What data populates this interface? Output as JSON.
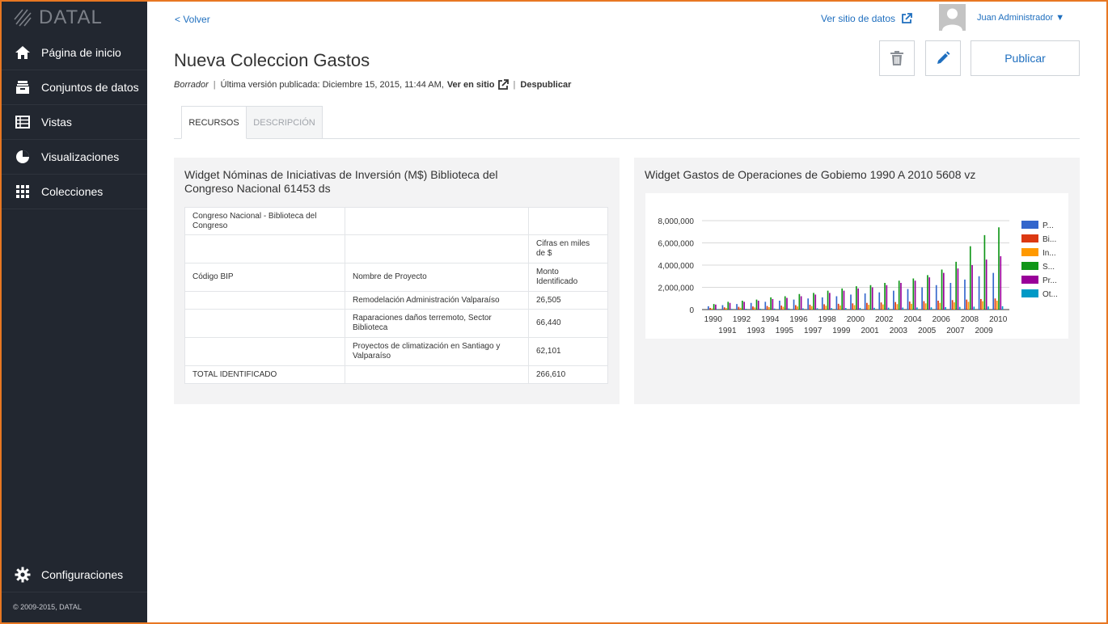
{
  "sidebar": {
    "brand": "DATAL",
    "items": [
      {
        "label": "Página de inicio"
      },
      {
        "label": "Conjuntos de datos"
      },
      {
        "label": "Vistas"
      },
      {
        "label": "Visualizaciones"
      },
      {
        "label": "Colecciones"
      }
    ],
    "settings_label": "Configuraciones",
    "copyright": "© 2009-2015, DATAL"
  },
  "header": {
    "back_label": "< Volver",
    "site_link_label": "Ver sitio de datos",
    "user_name": "Juan Administrador ▼",
    "title": "Nueva Coleccion Gastos",
    "status": "Borrador",
    "published_text": "Última versión publicada: Diciembre 15, 2015, 11:44 AM,",
    "view_on_site": "Ver en sitio",
    "unpublish": "Despublicar",
    "publish_button": "Publicar"
  },
  "tabs": [
    {
      "label": "RECURSOS"
    },
    {
      "label": "DESCRIPCIÓN"
    }
  ],
  "widget1": {
    "title": "Widget Nóminas de Iniciativas de Inversión (M$) Biblioteca del Congreso Nacional 61453 ds",
    "rows": [
      [
        "Congreso Nacional - Biblioteca del Congreso",
        "",
        ""
      ],
      [
        "",
        "",
        "Cifras en miles de $"
      ],
      [
        "Código BIP",
        "Nombre de Proyecto",
        "Monto Identificado"
      ],
      [
        "",
        "Remodelación Administración Valparaíso",
        "26,505"
      ],
      [
        "",
        "Raparaciones daños terremoto, Sector Biblioteca",
        "66,440"
      ],
      [
        "",
        "Proyectos de climatización en Santiago y Valparaíso",
        "62,101"
      ],
      [
        "TOTAL IDENTIFICADO",
        "",
        "266,610"
      ]
    ]
  },
  "widget2": {
    "title": "Widget Gastos de Operaciones de Gobiemo 1990 A 2010 5608 vz"
  },
  "chart_data": {
    "type": "bar",
    "title": "",
    "xlabel": "",
    "ylabel": "",
    "ylim": [
      0,
      8000000
    ],
    "y_ticks": [
      "0",
      "2,000,000",
      "4,000,000",
      "6,000,000",
      "8,000,000"
    ],
    "categories": [
      "1990",
      "1991",
      "1992",
      "1993",
      "1994",
      "1995",
      "1996",
      "1997",
      "1998",
      "1999",
      "2000",
      "2001",
      "2002",
      "2003",
      "2004",
      "2005",
      "2006",
      "2007",
      "2008",
      "2009",
      "2010"
    ],
    "legend_position": "right",
    "grid": true,
    "series": [
      {
        "name": "P...",
        "color": "#3366cc",
        "values": [
          300000,
          400000,
          500000,
          600000,
          700000,
          800000,
          900000,
          1000000,
          1100000,
          1200000,
          1350000,
          1450000,
          1550000,
          1700000,
          1850000,
          2000000,
          2200000,
          2400000,
          2700000,
          3000000,
          3300000
        ]
      },
      {
        "name": "Bi...",
        "color": "#dc3912",
        "values": [
          150000,
          200000,
          250000,
          280000,
          320000,
          360000,
          400000,
          440000,
          480000,
          520000,
          560000,
          600000,
          640000,
          680000,
          720000,
          760000,
          800000,
          850000,
          900000,
          950000,
          1000000
        ]
      },
      {
        "name": "In...",
        "color": "#ff9900",
        "values": [
          100000,
          130000,
          160000,
          190000,
          220000,
          250000,
          280000,
          310000,
          340000,
          370000,
          400000,
          430000,
          460000,
          490000,
          520000,
          560000,
          600000,
          650000,
          700000,
          750000,
          800000
        ]
      },
      {
        "name": "S...",
        "color": "#109618",
        "values": [
          500000,
          700000,
          800000,
          900000,
          1100000,
          1200000,
          1400000,
          1500000,
          1700000,
          1900000,
          2100000,
          2200000,
          2400000,
          2600000,
          2800000,
          3100000,
          3600000,
          4300000,
          5700000,
          6700000,
          7400000
        ]
      },
      {
        "name": "Pr...",
        "color": "#990099",
        "values": [
          450000,
          600000,
          700000,
          800000,
          950000,
          1050000,
          1200000,
          1350000,
          1500000,
          1700000,
          1900000,
          2000000,
          2200000,
          2400000,
          2600000,
          2900000,
          3300000,
          3700000,
          4000000,
          4500000,
          4800000
        ]
      },
      {
        "name": "Ot...",
        "color": "#0099c6",
        "values": [
          50000,
          60000,
          70000,
          80000,
          90000,
          100000,
          110000,
          120000,
          130000,
          140000,
          150000,
          160000,
          170000,
          180000,
          190000,
          200000,
          220000,
          240000,
          260000,
          280000,
          300000
        ]
      }
    ]
  }
}
